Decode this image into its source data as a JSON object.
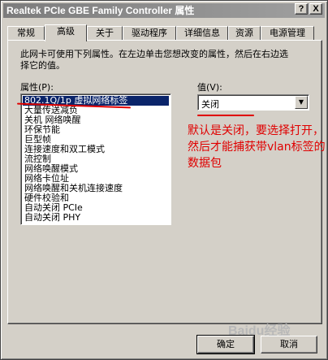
{
  "window": {
    "title": "Realtek PCIe GBE Family Controller 属性",
    "help_label": "?",
    "close_label": "X"
  },
  "tabs": [
    {
      "label": "常规"
    },
    {
      "label": "高级",
      "active": true
    },
    {
      "label": "关于"
    },
    {
      "label": "驱动程序"
    },
    {
      "label": "详细信息"
    },
    {
      "label": "资源"
    },
    {
      "label": "电源管理"
    }
  ],
  "advanced": {
    "description": "此网卡可使用下列属性。在左边单击您想改变的属性，然后在右边选择它的值。",
    "property_label": "属性(P):",
    "value_label": "值(V):",
    "properties": [
      {
        "label": "802.1Q/1p 虚拟网络标签",
        "selected": true
      },
      {
        "label": "大量传送减负"
      },
      {
        "label": "关机 网络唤醒"
      },
      {
        "label": "环保节能"
      },
      {
        "label": "巨型帧"
      },
      {
        "label": "连接速度和双工模式"
      },
      {
        "label": "流控制"
      },
      {
        "label": "网络唤醒模式"
      },
      {
        "label": "网络卡位址"
      },
      {
        "label": "网络唤醒和关机连接速度"
      },
      {
        "label": "硬件校验和"
      },
      {
        "label": "自动关闭 PCIe"
      },
      {
        "label": "自动关闭 PHY"
      }
    ],
    "value": "关闭"
  },
  "annotation": {
    "text": "默认是关闭，要选择打开，然后才能捕获带vlan标签的数据包",
    "color": "#e00000"
  },
  "buttons": {
    "ok_label": "确定",
    "cancel_label": "取消"
  },
  "watermark": "Baidu经验"
}
